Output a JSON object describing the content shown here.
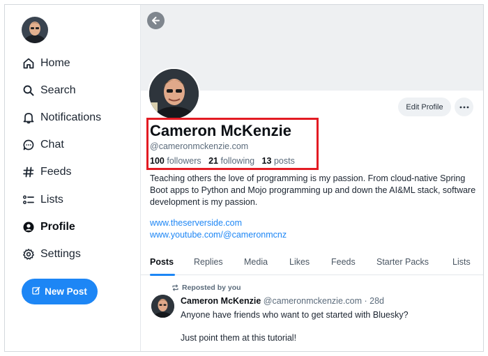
{
  "sidebar": {
    "items": [
      {
        "label": "Home",
        "icon": "home-icon"
      },
      {
        "label": "Search",
        "icon": "search-icon"
      },
      {
        "label": "Notifications",
        "icon": "bell-icon"
      },
      {
        "label": "Chat",
        "icon": "chat-icon"
      },
      {
        "label": "Feeds",
        "icon": "hash-icon"
      },
      {
        "label": "Lists",
        "icon": "list-icon"
      },
      {
        "label": "Profile",
        "icon": "person-icon",
        "active": true
      },
      {
        "label": "Settings",
        "icon": "gear-icon"
      }
    ],
    "new_post_label": "New Post"
  },
  "profile": {
    "edit_label": "Edit Profile",
    "name": "Cameron McKenzie",
    "handle": "@cameronmckenzie.com",
    "followers_count": "100",
    "followers_label": "followers",
    "following_count": "21",
    "following_label": "following",
    "posts_count": "13",
    "posts_label": "posts",
    "bio": "Teaching others the love of programming is my passion. From cloud-native Spring Boot apps to Python and Mojo programming up and down the AI&ML stack, software development is my passion.",
    "links": [
      "www.theserverside.com",
      "www.youtube.com/@cameronmcnz"
    ]
  },
  "tabs": [
    "Posts",
    "Replies",
    "Media",
    "Likes",
    "Feeds",
    "Starter Packs",
    "Lists"
  ],
  "post": {
    "repost_label": "Reposted by you",
    "author": "Cameron McKenzie",
    "handle": "@cameronmckenzie.com",
    "time": "· 28d",
    "text": "Anyone have friends who want to get started with Bluesky?",
    "text2": "Just point them at this tutorial!"
  },
  "colors": {
    "accent": "#1d86f5",
    "highlight": "#e31b23"
  }
}
